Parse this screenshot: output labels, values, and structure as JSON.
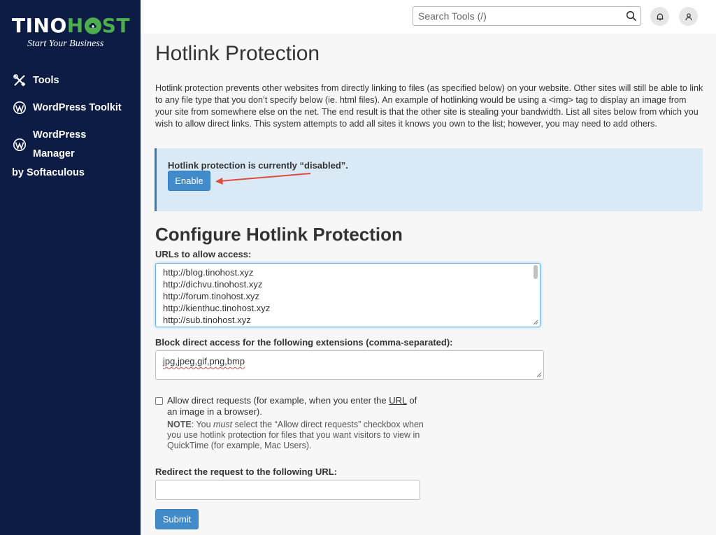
{
  "brand": {
    "name_part1": "TINO",
    "name_part2_h": "H",
    "name_part2_rest": "ST",
    "tagline": "Start Your Business",
    "accent_color": "#4cae4c",
    "sidebar_bg": "#0d1c44"
  },
  "sidebar": {
    "items": [
      {
        "label": "Tools",
        "icon": "tools-icon"
      },
      {
        "label": "WordPress Toolkit",
        "icon": "wordpress-icon"
      },
      {
        "label": "WordPress Manager",
        "label_line2": "by Softaculous",
        "icon": "wordpress-icon"
      }
    ]
  },
  "header": {
    "search_placeholder": "Search Tools (/)",
    "icons": [
      "search-icon",
      "bell-icon",
      "user-icon"
    ]
  },
  "page": {
    "title": "Hotlink Protection",
    "intro": "Hotlink protection prevents other websites from directly linking to files (as specified below) on your website. Other sites will still be able to link to any file type that you don’t specify below (ie. html files). An example of hotlinking would be using a <img> tag to display an image from your site from somewhere else on the net. The end result is that the other site is stealing your bandwidth. List all sites below from which you wish to allow direct links. This system attempts to add all sites it knows you own to the list; however, you may need to add others.",
    "status_text": "Hotlink protection is currently “disabled”.",
    "enable_label": "Enable",
    "config_title": "Configure Hotlink Protection",
    "urls_label": "URLs to allow access:",
    "urls": [
      "http://blog.tinohost.xyz",
      "http://dichvu.tinohost.xyz",
      "http://forum.tinohost.xyz",
      "http://kienthuc.tinohost.xyz",
      "http://sub.tinohost.xyz"
    ],
    "ext_label": "Block direct access for the following extensions (comma-separated):",
    "ext_value": "jpg,jpeg,gif,png,bmp",
    "allow_label_pre": "Allow direct requests (for example, when you enter the ",
    "allow_label_url": "URL",
    "allow_label_post": " of an image in a browser).",
    "note_label": "NOTE",
    "note_pre": ": You ",
    "note_must": "must",
    "note_post": " select the “Allow direct requests” checkbox when you use hotlink protection for files that you want visitors to view in QuickTime (for example, Mac Users).",
    "redirect_label": "Redirect the request to the following URL:",
    "redirect_value": "",
    "submit_label": "Submit"
  },
  "colors": {
    "primary_button": "#428bca",
    "alert_bg": "#d9e9f5",
    "arrow": "#e04b3a"
  }
}
